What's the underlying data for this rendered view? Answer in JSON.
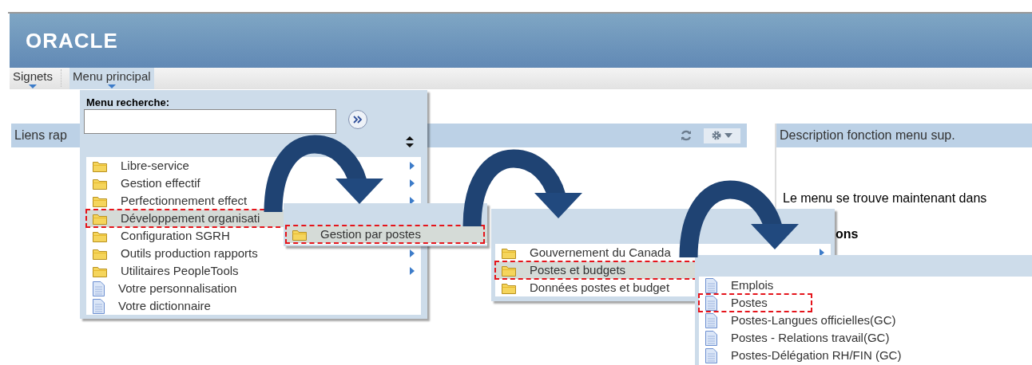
{
  "header": {
    "logo": "ORACLE"
  },
  "nav": [
    {
      "label": "Signets",
      "selected": false
    },
    {
      "label": "Menu principal",
      "selected": true
    }
  ],
  "quick_links": {
    "title": "Liens rap"
  },
  "description_panel": {
    "title": "Description fonction menu sup.",
    "text": "Le menu se trouve maintenant dans",
    "heading_fragment": "ons"
  },
  "menus": [
    {
      "search_label": "Menu recherche:",
      "items": [
        {
          "label": "Libre-service",
          "kind": "folder",
          "has_submenu": true,
          "selected": false,
          "annotated": false
        },
        {
          "label": "Gestion effectif",
          "kind": "folder",
          "has_submenu": true,
          "selected": false,
          "annotated": false
        },
        {
          "label": "Perfectionnement effect",
          "kind": "folder",
          "has_submenu": true,
          "selected": false,
          "annotated": false
        },
        {
          "label": "Développement organisati",
          "kind": "folder",
          "selected": true,
          "annotated": true
        },
        {
          "label": "Configuration SGRH",
          "kind": "folder",
          "selected": false,
          "annotated": false
        },
        {
          "label": "Outils production rapports",
          "kind": "folder",
          "has_submenu": true,
          "selected": false,
          "annotated": false
        },
        {
          "label": "Utilitaires PeopleTools",
          "kind": "folder",
          "has_submenu": true,
          "selected": false,
          "annotated": false
        },
        {
          "label": "Votre personnalisation",
          "kind": "page",
          "has_submenu": false,
          "selected": false,
          "annotated": false
        },
        {
          "label": "Votre dictionnaire",
          "kind": "page",
          "has_submenu": false,
          "selected": false,
          "annotated": false
        }
      ]
    },
    {
      "items": [
        {
          "label": "Gestion par postes",
          "kind": "folder",
          "has_submenu": false,
          "selected": true,
          "annotated": true
        }
      ]
    },
    {
      "items": [
        {
          "label": "Gouvernement du Canada",
          "kind": "folder",
          "has_submenu": true,
          "selected": false,
          "annotated": false
        },
        {
          "label": "Postes et budgets",
          "kind": "folder",
          "selected": true,
          "annotated": true
        },
        {
          "label": "Données postes et budget",
          "kind": "folder",
          "selected": false,
          "annotated": false
        }
      ]
    },
    {
      "items": [
        {
          "label": "Emplois",
          "kind": "page",
          "has_submenu": false,
          "selected": false,
          "annotated": false
        },
        {
          "label": "Postes",
          "kind": "page",
          "has_submenu": false,
          "selected": false,
          "annotated": true
        },
        {
          "label": "Postes-Langues officielles(GC)",
          "kind": "page",
          "has_submenu": false,
          "selected": false,
          "annotated": false
        },
        {
          "label": "Postes - Relations travail(GC)",
          "kind": "page",
          "has_submenu": false,
          "selected": false,
          "annotated": false
        },
        {
          "label": "Postes-Délégation RH/FIN (GC)",
          "kind": "page",
          "has_submenu": false,
          "selected": false,
          "annotated": false
        }
      ]
    }
  ]
}
